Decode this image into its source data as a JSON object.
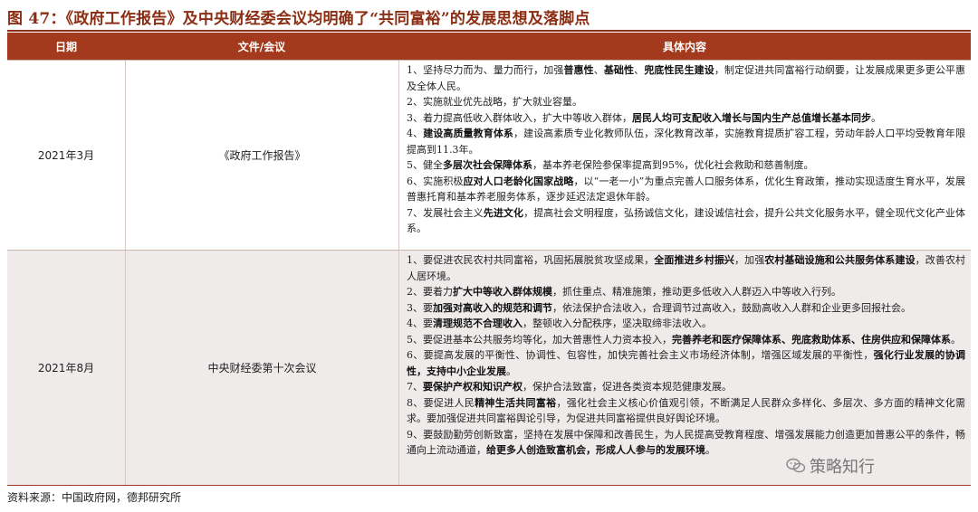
{
  "title": "图 47：《政府工作报告》及中央财经委会议均明确了“共同富裕”的发展思想及落脚点",
  "table": {
    "headers": [
      "日期",
      "文件/会议",
      "具体内容"
    ],
    "rows": [
      {
        "date": "2021年3月",
        "doc": "《政府工作报告》",
        "items": [
          [
            [
              "1、坚持尽力而为、量力而行，加强",
              false
            ],
            [
              "普惠性",
              true
            ],
            [
              "、",
              false
            ],
            [
              "基础性",
              true
            ],
            [
              "、",
              false
            ],
            [
              "兜底性民生建设",
              true
            ],
            [
              "，制定促进共同富裕行动纲要，让发展成果更多更公平惠及全体人民。",
              false
            ]
          ],
          [
            [
              "2、实施就业优先战略，扩大就业容量。",
              false
            ]
          ],
          [
            [
              "3、着力提高低收入群体收入，扩大中等收入群体，",
              false
            ],
            [
              "居民人均可支配收入增长与国内生产总值增长基本同步",
              true
            ],
            [
              "。",
              false
            ]
          ],
          [
            [
              "4、",
              false
            ],
            [
              "建设高质量教育体系",
              true
            ],
            [
              "，建设高素质专业化教师队伍，深化教育改革，实施教育提质扩容工程，劳动年龄人口平均受教育年限提高到11.3年。",
              false
            ]
          ],
          [
            [
              "5、健全",
              false
            ],
            [
              "多层次社会保障体系",
              true
            ],
            [
              "，基本养老保险参保率提高到95%，优化社会救助和慈善制度。",
              false
            ]
          ],
          [
            [
              "6、实施积极",
              false
            ],
            [
              "应对人口老龄化国家战略",
              true
            ],
            [
              "，以“一老一小”为重点完善人口服务体系，优化生育政策，推动实现适度生育水平，发展普惠托育和基本养老服务体系，逐步延迟法定退休年龄。",
              false
            ]
          ],
          [
            [
              "7、发展社会主义",
              false
            ],
            [
              "先进文化",
              true
            ],
            [
              "，提高社会文明程度，弘扬诚信文化，建设诚信社会，提升公共文化服务水平，健全现代文化产业体系。",
              false
            ]
          ]
        ]
      },
      {
        "date": "2021年8月",
        "doc": "中央财经委第十次会议",
        "items": [
          [
            [
              "1、要促进农民农村共同富裕，巩固拓展脱贫攻坚成果，",
              false
            ],
            [
              "全面推进乡村振兴",
              true
            ],
            [
              "，加强",
              false
            ],
            [
              "农村基础设施和公共服务体系建设",
              true
            ],
            [
              "，改善农村人居环境。",
              false
            ]
          ],
          [
            [
              "2、要着力",
              false
            ],
            [
              "扩大中等收入群体规模",
              true
            ],
            [
              "，抓住重点、精准施策，推动更多低收入人群迈入中等收入行列。",
              false
            ]
          ],
          [
            [
              "3、要",
              false
            ],
            [
              "加强对高收入的规范和调节",
              true
            ],
            [
              "，依法保护合法收入，合理调节过高收入，鼓励高收入人群和企业更多回报社会。",
              false
            ]
          ],
          [
            [
              "4、要",
              false
            ],
            [
              "清理规范不合理收入",
              true
            ],
            [
              "，整顿收入分配秩序，坚决取缔非法收入。",
              false
            ]
          ],
          [
            [
              "5、要促进基本公共服务均等化，加大普惠性人力资本投入，",
              false
            ],
            [
              "完善养老和医疗保障体系、兜底救助体系、住房供应和保障体系",
              true
            ],
            [
              "。",
              false
            ]
          ],
          [
            [
              "6、要提高发展的平衡性、协调性、包容性，加快完善社会主义市场经济体制，增强区域发展的平衡性，",
              false
            ],
            [
              "强化行业发展的协调性，支持中小企业发展",
              true
            ],
            [
              "。",
              false
            ]
          ],
          [
            [
              "7、",
              false
            ],
            [
              "要保护产权和知识产权",
              true
            ],
            [
              "，保护合法致富，促进各类资本规范健康发展。",
              false
            ]
          ],
          [
            [
              "8、要促进人民",
              false
            ],
            [
              "精神生活共同富裕",
              true
            ],
            [
              "，强化社会主义核心价值观引领，不断满足人民群众多样化、多层次、多方面的精神文化需求。要加强促进共同富裕舆论引导，为促进共同富裕提供良好舆论环境。",
              false
            ]
          ],
          [
            [
              "9、要鼓励勤劳创新致富，坚持在发展中保障和改善民生，为人民提高受教育程度、增强发展能力创造更加普惠公平的条件，畅通向上流动通道，",
              false
            ],
            [
              "给更多人创造致富机会，形成人人参与的发展环境",
              true
            ],
            [
              "。",
              false
            ]
          ]
        ]
      }
    ]
  },
  "source": "资料来源：中国政府网，德邦研究所",
  "watermark": "策略知行",
  "colors": {
    "header_bg": "#a43a1d",
    "title": "#8b2e14",
    "alt_row": "#eeebea"
  }
}
